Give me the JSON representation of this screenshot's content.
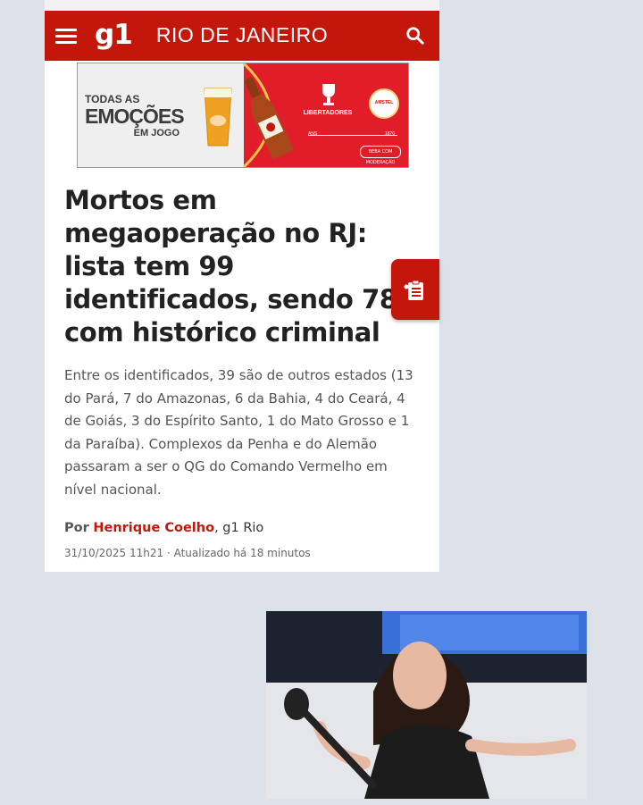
{
  "header": {
    "logo": "g1",
    "section": "RIO DE JANEIRO",
    "menu_icon": "menu-icon",
    "search_icon": "search-icon",
    "color": "#c4170c"
  },
  "ad": {
    "tagline_1": "TODAS AS",
    "tagline_2": "EMOÇÕES",
    "tagline_3": "EM JOGO",
    "competition": "LIBERTADORES",
    "brand": "AMSTEL",
    "year_left": "ANS",
    "year_right": "1870",
    "cta": "BEBA COM MODERAÇÃO"
  },
  "article": {
    "headline": "Mortos em megaoperação no RJ: lista tem 99 identificados, sendo 78 com histórico criminal",
    "summary": "Entre os identificados, 39 são de outros estados (13 do Pará, 7 do Amazonas, 6 da Bahia, 4 do Ceará, 4 de Goiás, 3 do Espírito Santo, 1 do Mato Grosso e 1 da Paraíba). Complexos da Penha e do Alemão passaram a ser o QG do Comando Vermelho em nível nacional.",
    "by_prefix": "Por",
    "author": "Henrique Coelho",
    "source": ", g1 Rio",
    "dateline": "31/10/2025 11h21 · Atualizado há 18 minutos"
  },
  "floating_button": {
    "icon": "clipboard-list-icon"
  },
  "reaction_image": {
    "description_icon": "woman-shrug-photo"
  }
}
